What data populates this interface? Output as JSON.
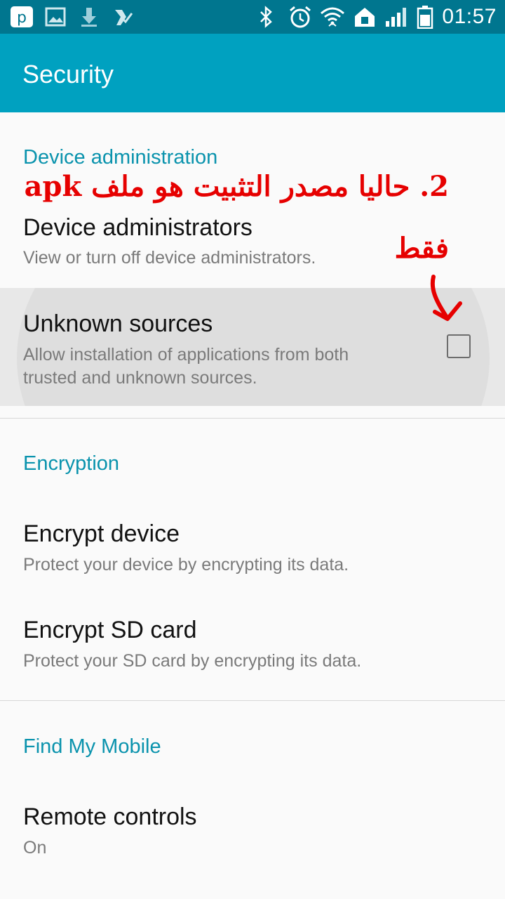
{
  "status_bar": {
    "time": "01:57",
    "left_icons": [
      "notification-app-icon",
      "image-icon",
      "download-icon",
      "check-icon"
    ],
    "right_icons": [
      "bluetooth-icon",
      "alarm-icon",
      "wifi-icon",
      "home-icon",
      "signal-icon",
      "battery-icon"
    ]
  },
  "app_bar": {
    "title": "Security"
  },
  "sections": {
    "device_admin": {
      "header": "Device administration",
      "device_administrators": {
        "title": "Device administrators",
        "subtitle": "View or turn off device administrators."
      },
      "unknown_sources": {
        "title": "Unknown sources",
        "subtitle_line1": "Allow installation of applications from both",
        "subtitle_line2": "trusted and unknown sources.",
        "checked": false
      }
    },
    "encryption": {
      "header": "Encryption",
      "encrypt_device": {
        "title": "Encrypt device",
        "subtitle": "Protect your device by encrypting its data."
      },
      "encrypt_sd": {
        "title": "Encrypt SD card",
        "subtitle": "Protect your SD card by encrypting its data."
      }
    },
    "find_my_mobile": {
      "header": "Find My Mobile",
      "remote_controls": {
        "title": "Remote controls",
        "subtitle": "On"
      }
    }
  },
  "annotation": {
    "line1": "2. حاليا مصدر التثبيت هو ملف apk",
    "line2": "فقط",
    "color": "#e60000"
  },
  "colors": {
    "status_bar": "#00768f",
    "app_bar": "#00a1c0",
    "accent": "#0a93ad"
  }
}
